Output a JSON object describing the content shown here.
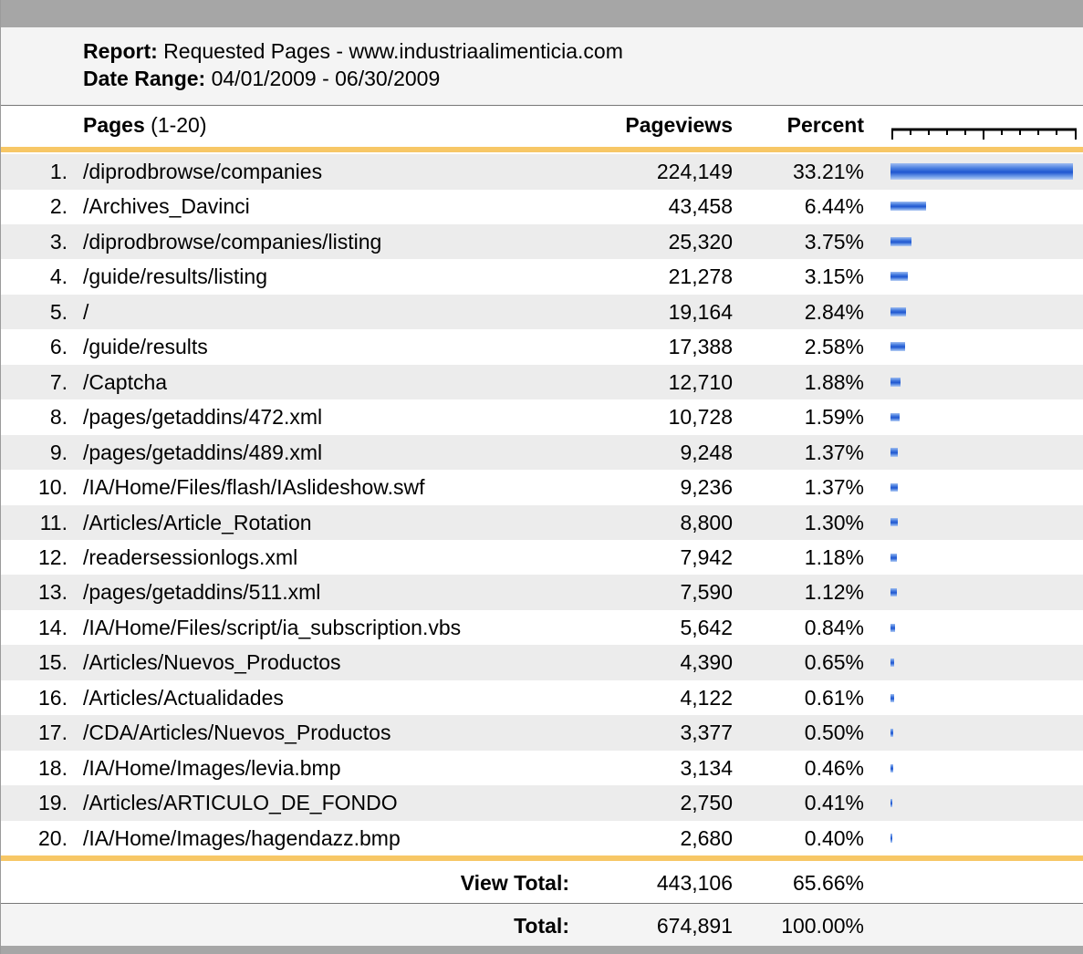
{
  "header": {
    "report_label": "Report:",
    "report_value": "Requested Pages - www.industriaalimenticia.com",
    "date_label": "Date Range:",
    "date_value": "04/01/2009 - 06/30/2009"
  },
  "columns": {
    "pages_label": "Pages",
    "pages_range": "(1-20)",
    "pageviews": "Pageviews",
    "percent": "Percent"
  },
  "rows": [
    {
      "rank": "1.",
      "page": "/diprodbrowse/companies",
      "pageviews": "224,149",
      "percent": "33.21%",
      "share": 33.21
    },
    {
      "rank": "2.",
      "page": "/Archives_Davinci",
      "pageviews": "43,458",
      "percent": "6.44%",
      "share": 6.44
    },
    {
      "rank": "3.",
      "page": "/diprodbrowse/companies/listing",
      "pageviews": "25,320",
      "percent": "3.75%",
      "share": 3.75
    },
    {
      "rank": "4.",
      "page": "/guide/results/listing",
      "pageviews": "21,278",
      "percent": "3.15%",
      "share": 3.15
    },
    {
      "rank": "5.",
      "page": "/",
      "pageviews": "19,164",
      "percent": "2.84%",
      "share": 2.84
    },
    {
      "rank": "6.",
      "page": "/guide/results",
      "pageviews": "17,388",
      "percent": "2.58%",
      "share": 2.58
    },
    {
      "rank": "7.",
      "page": "/Captcha",
      "pageviews": "12,710",
      "percent": "1.88%",
      "share": 1.88
    },
    {
      "rank": "8.",
      "page": "/pages/getaddins/472.xml",
      "pageviews": "10,728",
      "percent": "1.59%",
      "share": 1.59
    },
    {
      "rank": "9.",
      "page": "/pages/getaddins/489.xml",
      "pageviews": "9,248",
      "percent": "1.37%",
      "share": 1.37
    },
    {
      "rank": "10.",
      "page": "/IA/Home/Files/flash/IAslideshow.swf",
      "pageviews": "9,236",
      "percent": "1.37%",
      "share": 1.37
    },
    {
      "rank": "11.",
      "page": "/Articles/Article_Rotation",
      "pageviews": "8,800",
      "percent": "1.30%",
      "share": 1.3
    },
    {
      "rank": "12.",
      "page": "/readersessionlogs.xml",
      "pageviews": "7,942",
      "percent": "1.18%",
      "share": 1.18
    },
    {
      "rank": "13.",
      "page": "/pages/getaddins/511.xml",
      "pageviews": "7,590",
      "percent": "1.12%",
      "share": 1.12
    },
    {
      "rank": "14.",
      "page": "/IA/Home/Files/script/ia_subscription.vbs",
      "pageviews": "5,642",
      "percent": "0.84%",
      "share": 0.84
    },
    {
      "rank": "15.",
      "page": "/Articles/Nuevos_Productos",
      "pageviews": "4,390",
      "percent": "0.65%",
      "share": 0.65
    },
    {
      "rank": "16.",
      "page": "/Articles/Actualidades",
      "pageviews": "4,122",
      "percent": "0.61%",
      "share": 0.61
    },
    {
      "rank": "17.",
      "page": "/CDA/Articles/Nuevos_Productos",
      "pageviews": "3,377",
      "percent": "0.50%",
      "share": 0.5
    },
    {
      "rank": "18.",
      "page": "/IA/Home/Images/levia.bmp",
      "pageviews": "3,134",
      "percent": "0.46%",
      "share": 0.46
    },
    {
      "rank": "19.",
      "page": "/Articles/ARTICULO_DE_FONDO",
      "pageviews": "2,750",
      "percent": "0.41%",
      "share": 0.41
    },
    {
      "rank": "20.",
      "page": "/IA/Home/Images/hagendazz.bmp",
      "pageviews": "2,680",
      "percent": "0.40%",
      "share": 0.4
    }
  ],
  "view_total": {
    "label": "View Total:",
    "pageviews": "443,106",
    "percent": "65.66%"
  },
  "total": {
    "label": "Total:",
    "pageviews": "674,891",
    "percent": "100.00%"
  },
  "colors": {
    "bar": "#1f56d0",
    "rule": "#f7c766",
    "frame": "#a6a6a6",
    "alt_row": "#ececec"
  }
}
